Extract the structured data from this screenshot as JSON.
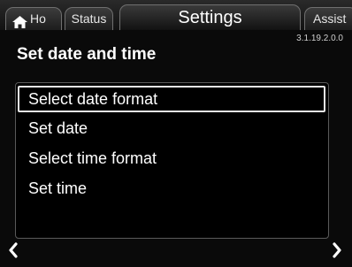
{
  "tabs": {
    "home_label": "Ho",
    "status_label": "Status",
    "settings_label": "Settings",
    "assist_label": "Assist"
  },
  "version": "3.1.19.2.0.0",
  "page_title": "Set date and time",
  "menu": {
    "items": [
      {
        "label": "Select date format",
        "selected": true
      },
      {
        "label": "Set date",
        "selected": false
      },
      {
        "label": "Select time format",
        "selected": false
      },
      {
        "label": "Set time",
        "selected": false
      }
    ]
  },
  "icons": {
    "home": "home-icon",
    "prev": "chevron-left-icon",
    "next": "chevron-right-icon"
  }
}
